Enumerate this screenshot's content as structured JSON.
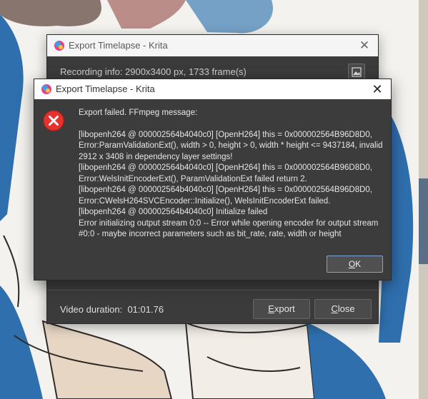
{
  "back_dialog": {
    "title": "Export Timelapse - Krita",
    "close_glyph": "✕",
    "recording_info": "Recording info: 2900x3400 px, 1733 frame(s)",
    "video_duration_label": "Video duration:",
    "video_duration_value": "01:01.76",
    "export_label_hot": "E",
    "export_label_rest": "xport",
    "close_label_hot": "C",
    "close_label_rest": "lose",
    "icons": {
      "app": "krita-icon",
      "image_button": "image-icon",
      "close": "close-icon"
    }
  },
  "front_dialog": {
    "title": "Export Timelapse - Krita",
    "close_glyph": "✕",
    "headline": "Export failed. FFmpeg message:",
    "detail": "[libopenh264 @ 000002564b4040c0] [OpenH264] this = 0x000002564B96D8D0, Error:ParamValidationExt(), width > 0, height > 0, width * height <= 9437184, invalid 2912 x 3408 in dependency layer settings!\n[libopenh264 @ 000002564b4040c0] [OpenH264] this = 0x000002564B96D8D0, Error:WelsInitEncoderExt(), ParamValidationExt failed return 2.\n[libopenh264 @ 000002564b4040c0] [OpenH264] this = 0x000002564B96D8D0, Error:CWelsH264SVCEncoder::Initialize(), WelsInitEncoderExt failed.\n[libopenh264 @ 000002564b4040c0] Initialize failed\nError initializing output stream 0:0 -- Error while opening encoder for output stream #0:0 - maybe incorrect parameters such as bit_rate, rate, width or height",
    "ok_label_hot": "O",
    "ok_label_rest": "K",
    "icons": {
      "app": "krita-icon",
      "error": "error-icon",
      "close": "close-icon"
    }
  },
  "colors": {
    "dialog_bg": "#3c3c3c",
    "error_red": "#e5322d",
    "ok_focus_border": "#7fa7d6"
  }
}
